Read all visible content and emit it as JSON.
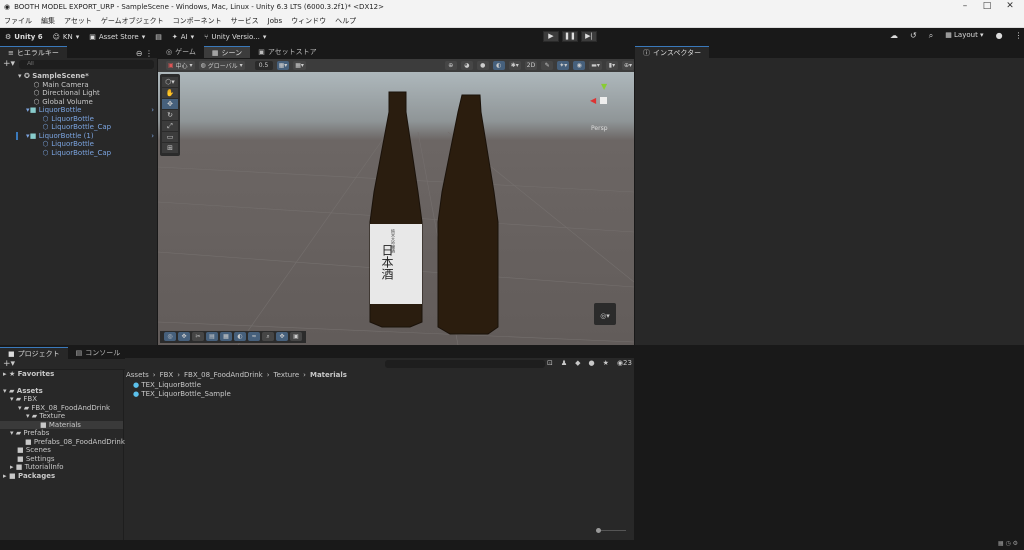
{
  "window": {
    "title": "BOOTH MODEL EXPORT_URP - SampleScene - Windows, Mac, Linux - Unity 6.3 LTS (6000.3.2f1)* <DX12>"
  },
  "menu": [
    "ファイル",
    "編集",
    "アセット",
    "ゲームオブジェクト",
    "コンポーネント",
    "サービス",
    "Jobs",
    "ウィンドウ",
    "ヘルプ"
  ],
  "toolbar": {
    "unity": "Unity 6",
    "account": "KN",
    "asset_store": "Asset Store",
    "ai": "AI",
    "version_control": "Unity Versio...",
    "layout": "Layout"
  },
  "hierarchy": {
    "tab": "ヒエラルキー",
    "search_placeholder": "All",
    "scene": "SampleScene*",
    "items": [
      {
        "label": "Main Camera"
      },
      {
        "label": "Directional Light"
      },
      {
        "label": "Global Volume"
      },
      {
        "label": "LiquorBottle"
      },
      {
        "label": "LiquorBottle"
      },
      {
        "label": "LiquorBottle_Cap"
      },
      {
        "label": "LiquorBottle (1)"
      },
      {
        "label": "LiquorBottle"
      },
      {
        "label": "LiquorBottle_Cap"
      }
    ]
  },
  "center_tabs": [
    "ゲーム",
    "シーン",
    "アセットストア"
  ],
  "scene": {
    "pivot": "中心",
    "space": "グローバル",
    "snap": "0.5",
    "persp": "Persp",
    "label_small": "純米大吟醸酒",
    "label_big": "日本酒"
  },
  "inspector": {
    "tab": "インスペクター"
  },
  "project": {
    "tabs": [
      "プロジェクト",
      "コンソール"
    ],
    "favorites": "Favorites",
    "tree": [
      {
        "label": "Assets"
      },
      {
        "label": "FBX"
      },
      {
        "label": "FBX_08_FoodAndDrink"
      },
      {
        "label": "Texture"
      },
      {
        "label": "Materials"
      },
      {
        "label": "Prefabs"
      },
      {
        "label": "Prefabs_08_FoodAndDrink"
      },
      {
        "label": "Scenes"
      },
      {
        "label": "Settings"
      },
      {
        "label": "TutorialInfo"
      },
      {
        "label": "Packages"
      }
    ],
    "breadcrumb": [
      "Assets",
      "FBX",
      "FBX_08_FoodAndDrink",
      "Texture",
      "Materials"
    ],
    "files": [
      "TEX_LiquorBottle",
      "TEX_LiquorBottle_Sample"
    ],
    "hidden_count": "23"
  }
}
